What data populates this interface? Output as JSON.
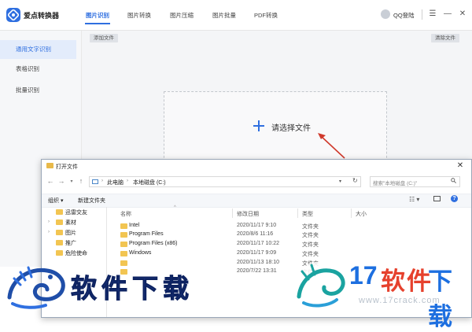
{
  "app": {
    "title": "爱点转换器",
    "nav_tabs": [
      "图片识别",
      "图片转换",
      "图片压缩",
      "图片批量",
      "PDF转换"
    ],
    "active_tab": "图片识别",
    "login": "QQ登陆",
    "window_buttons": {
      "menu": "☰",
      "minimize": "—",
      "close": "✕"
    },
    "colors": {
      "accent": "#2f6fe0",
      "sidebar_bg": "#f6f7f9",
      "sidebar_active_bg": "#e3ecfb",
      "annotation_arrow": "#d03a2c"
    }
  },
  "sidebar": {
    "items": [
      {
        "label": "通用文字识别",
        "active": true
      },
      {
        "label": "表格识别",
        "active": false
      },
      {
        "label": "批量识别",
        "active": false
      }
    ]
  },
  "main": {
    "add_file": "添加文件",
    "clear_files": "清除文件",
    "choose_file": "请选择文件"
  },
  "dialog": {
    "title": "打开文件",
    "breadcrumb": [
      "此电脑",
      "本地磁盘 (C:)"
    ],
    "search_placeholder": "搜索\"本地磁盘 (C:)\"",
    "toolbar": {
      "organize": "组织 ▾",
      "new_folder": "新建文件夹"
    },
    "nav_items": [
      {
        "label": "迅雷交友",
        "expandable": false
      },
      {
        "label": "素材",
        "expandable": true
      },
      {
        "label": "图片",
        "expandable": true
      },
      {
        "label": "推广",
        "expandable": false
      },
      {
        "label": "危险使命",
        "expandable": false
      }
    ],
    "columns": [
      "名称",
      "修改日期",
      "类型",
      "大小"
    ],
    "files": [
      {
        "name": "Intel",
        "date": "2020/11/17 9:10",
        "type": "文件夹"
      },
      {
        "name": "Program Files",
        "date": "2020/8/6 11:16",
        "type": "文件夹"
      },
      {
        "name": "Program Files (x86)",
        "date": "2020/11/17 10:22",
        "type": "文件夹"
      },
      {
        "name": "Windows",
        "date": "2020/11/17 9:09",
        "type": "文件夹"
      },
      {
        "name": "",
        "date": "2020/11/13 18:10",
        "type": "文件夹"
      },
      {
        "name": "",
        "date": "2020/7/22 13:31",
        "type": "文件夹"
      }
    ]
  },
  "watermark": {
    "left_text": "软件下载",
    "right_num": "17",
    "right_cn": "软件",
    "right_cn2": "下载",
    "url": "www.17crack.com"
  }
}
